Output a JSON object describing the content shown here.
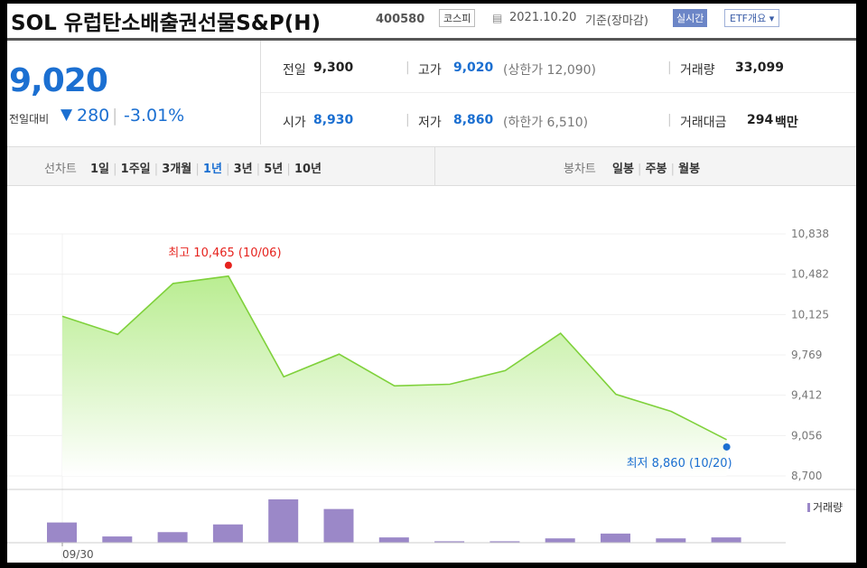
{
  "header": {
    "title": "SOL 유럽탄소배출권선물S&P(H)",
    "code": "400580",
    "market": "코스피",
    "date": "2021.10.20",
    "date_note": "기준(장마감)",
    "realtime_label": "실시간",
    "etf_overview_label": "ETF개요 ▾"
  },
  "price": {
    "current": "9,020",
    "change_label": "전일대비",
    "change_arrow": "▼",
    "change_value": "280",
    "change_percent": "-3.01%"
  },
  "stats": {
    "prev_close_label": "전일",
    "prev_close": "9,300",
    "high_label": "고가",
    "high": "9,020",
    "upper_limit": "(상한가 12,090)",
    "volume_label": "거래량",
    "volume": "33,099",
    "open_label": "시가",
    "open": "8,930",
    "low_label": "저가",
    "low": "8,860",
    "lower_limit": "(하한가 6,510)",
    "trade_value_label": "거래대금",
    "trade_value": "294",
    "trade_value_unit": "백만"
  },
  "tabs": {
    "line_label": "선차트",
    "periods": [
      "1일",
      "1주일",
      "3개월",
      "1년",
      "3년",
      "5년",
      "10년"
    ],
    "active_period": "1년",
    "candle_label": "봉차트",
    "candle_periods": [
      "일봉",
      "주봉",
      "월봉"
    ]
  },
  "colors": {
    "area_line": "#7fd13b",
    "area_fill_top": "#b6ec8c",
    "volume_bar": "#9b88c8",
    "high_marker": "#e6231e",
    "low_marker": "#1b6fd1",
    "active_tab": "#1b6fd1"
  },
  "chart_data": {
    "type": "area",
    "ylim": [
      8700,
      10838
    ],
    "y_ticks": [
      "10,838",
      "10,482",
      "10,125",
      "9,769",
      "9,412",
      "9,056",
      "8,700"
    ],
    "x_tick_labels": [
      "09/30"
    ],
    "series": [
      {
        "values": [
          10110,
          9950,
          10400,
          10465,
          9575,
          9775,
          9495,
          9510,
          9630,
          9960,
          9420,
          9270,
          9020
        ]
      }
    ],
    "volume": {
      "legend": "거래량",
      "values": [
        42,
        13,
        22,
        38,
        90,
        70,
        11,
        3,
        3,
        9,
        19,
        9,
        11
      ]
    },
    "annotations": {
      "high": {
        "text": "최고 10,465 (10/06)",
        "value": 10465,
        "index": 3
      },
      "low": {
        "text": "최저 8,860 (10/20)",
        "value": 8860,
        "index": 12
      }
    }
  }
}
